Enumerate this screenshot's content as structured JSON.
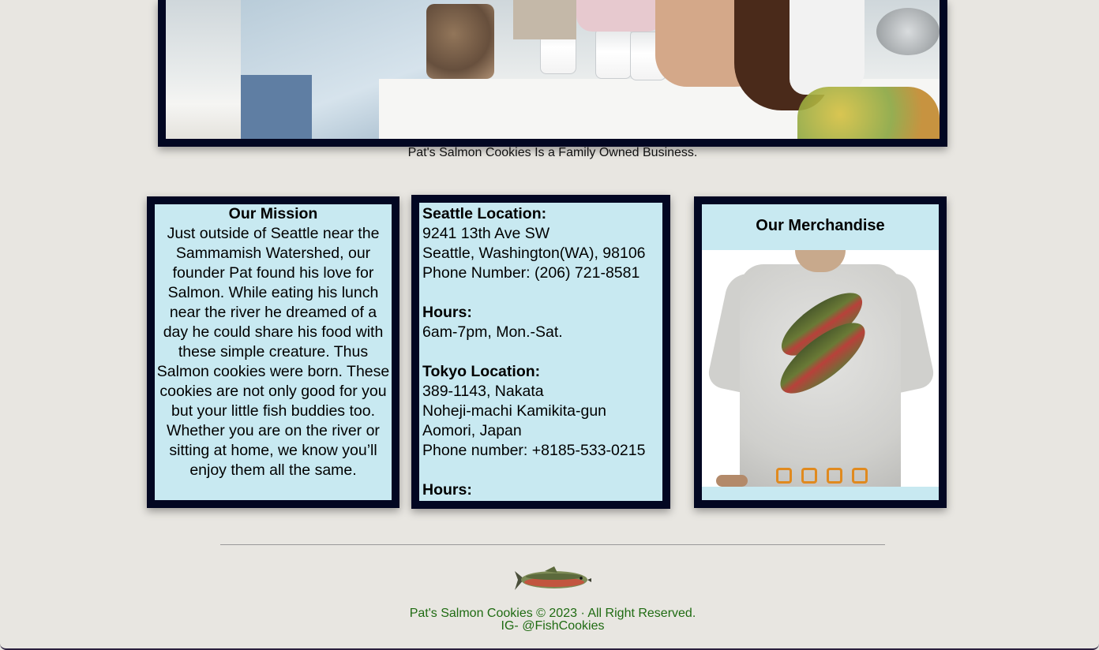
{
  "hero": {
    "caption": "Pat's Salmon Cookies Is a Family Owned Business."
  },
  "mission": {
    "title": "Our Mission",
    "body": "Just outside of Seattle near the Sammamish Watershed, our founder Pat found his love for Salmon. While eating his lunch near the river he dreamed of a day he could share his food with these simple creature. Thus Salmon cookies were born. These cookies are not only good for you but your little fish buddies too. Whether you are on the river or sitting at home, we know you’ll enjoy them all the same."
  },
  "locations": {
    "seattle_heading": "Seattle Location:",
    "seattle_address1": "9241 13th Ave SW",
    "seattle_address2": "Seattle, Washington(WA), 98106",
    "seattle_phone": "Phone Number: (206) 721-8581",
    "seattle_hours_heading": "Hours:",
    "seattle_hours": "6am-7pm, Mon.-Sat.",
    "tokyo_heading": "Tokyo Location:",
    "tokyo_address1": "389-1143, Nakata",
    "tokyo_address2": "Noheji-machi Kamikita-gun",
    "tokyo_address3": "Aomori, Japan",
    "tokyo_phone": "Phone number: +8185-533-0215",
    "tokyo_hours_heading": "Hours:"
  },
  "merchandise": {
    "title": "Our Merchandise",
    "carousel_dot_count": 4,
    "dot_color": "#e08a1f"
  },
  "footer": {
    "copyright": "Pat's Salmon Cookies © 2023 · All Right Reserved.",
    "social": "IG- @FishCookies",
    "text_color": "#1f6b12"
  },
  "colors": {
    "page_bg": "#e8e6e1",
    "card_border": "#020722",
    "card_bg": "#c8e9f1"
  }
}
